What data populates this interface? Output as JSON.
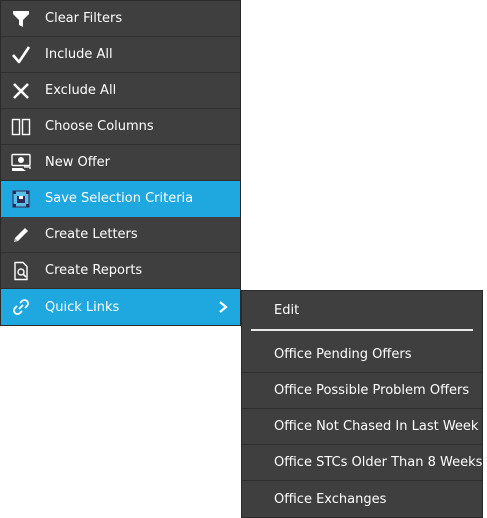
{
  "menu": {
    "items": [
      {
        "label": "Clear Filters",
        "icon": "filter-icon"
      },
      {
        "label": "Include All",
        "icon": "checkmark-icon"
      },
      {
        "label": "Exclude All",
        "icon": "x-icon"
      },
      {
        "label": "Choose Columns",
        "icon": "columns-icon"
      },
      {
        "label": "New Offer",
        "icon": "new-offer-icon"
      },
      {
        "label": "Save Selection Criteria",
        "icon": "save-selection-icon",
        "highlighted": true
      },
      {
        "label": "Create Letters",
        "icon": "pencil-icon"
      },
      {
        "label": "Create Reports",
        "icon": "report-search-icon"
      },
      {
        "label": "Quick Links",
        "icon": "link-icon",
        "highlighted": true,
        "has_submenu": true
      }
    ]
  },
  "submenu": {
    "edit_label": "Edit",
    "items": [
      {
        "label": "Office Pending Offers"
      },
      {
        "label": "Office Possible Problem Offers"
      },
      {
        "label": "Office Not Chased In Last Week"
      },
      {
        "label": "Office STCs Older Than 8 Weeks"
      },
      {
        "label": "Office Exchanges"
      }
    ]
  },
  "colors": {
    "menu_bg": "#3f3f3f",
    "highlight": "#1fa8e0",
    "text": "#ffffff"
  }
}
